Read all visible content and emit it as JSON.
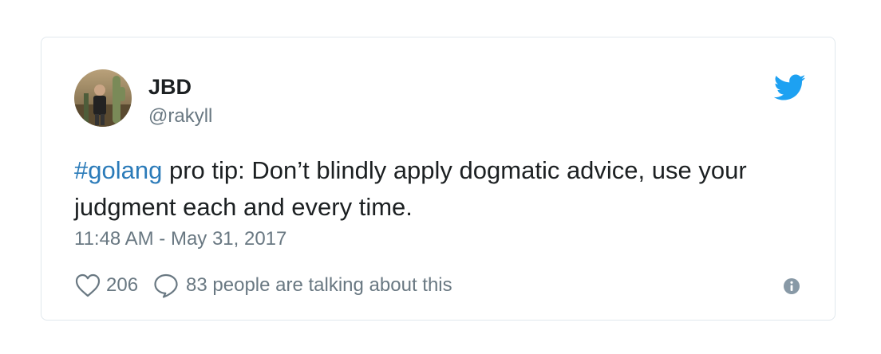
{
  "author": {
    "display_name": "JBD",
    "handle": "@rakyll"
  },
  "tweet": {
    "hashtag": "#golang",
    "text": " pro tip: Don’t blindly apply dogmatic advice, use your judgment each and every time.",
    "timestamp": "11:48 AM - May 31, 2017"
  },
  "actions": {
    "like_count": "206",
    "talking_text": "83 people are talking about this"
  },
  "icons": {
    "brand": "twitter-bird-icon",
    "like": "heart-icon",
    "reply": "reply-bubble-icon",
    "info": "info-icon"
  },
  "colors": {
    "brand_blue": "#1da1f2",
    "link_blue": "#2b7bb9",
    "secondary_text": "#697882",
    "primary_text": "#1c2022",
    "card_border": "#e1e8ed"
  }
}
